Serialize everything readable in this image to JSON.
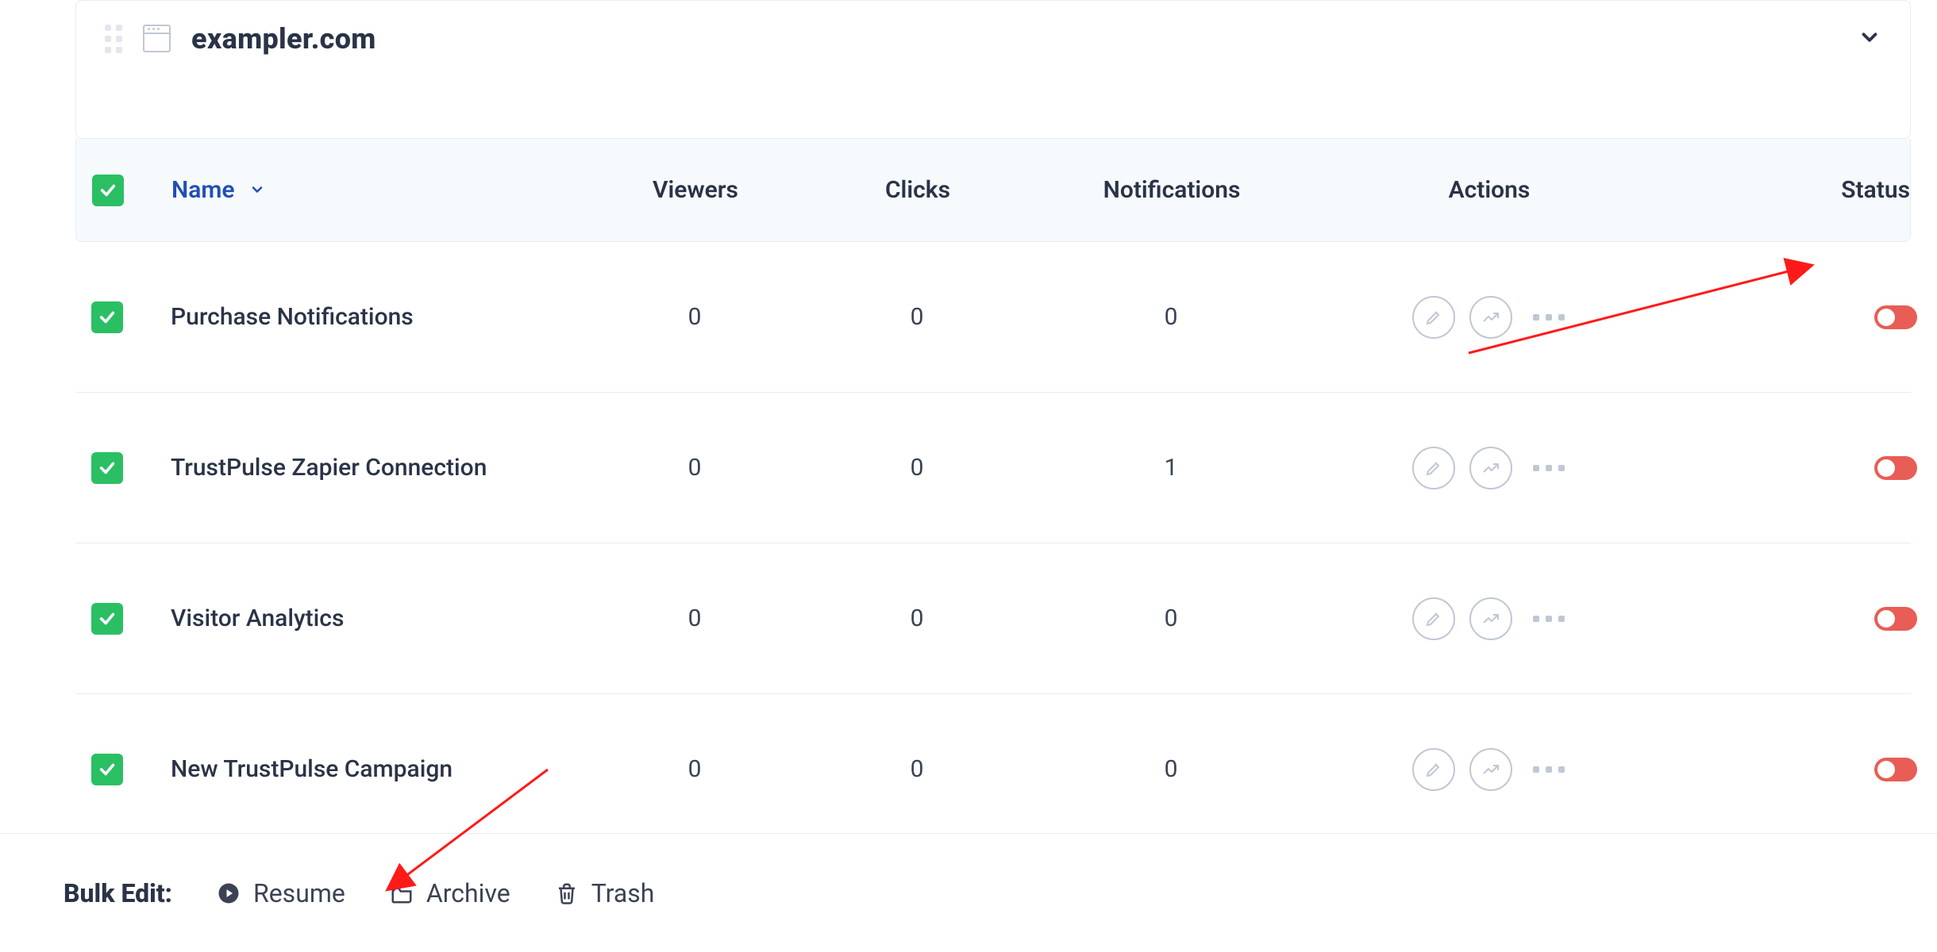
{
  "site": {
    "title": "exampler.com"
  },
  "columns": {
    "name": "Name",
    "viewers": "Viewers",
    "clicks": "Clicks",
    "notifications": "Notifications",
    "actions": "Actions",
    "status": "Status"
  },
  "rows": [
    {
      "name": "Purchase Notifications",
      "viewers": "0",
      "clicks": "0",
      "notifications": "0"
    },
    {
      "name": "TrustPulse Zapier Connection",
      "viewers": "0",
      "clicks": "0",
      "notifications": "1"
    },
    {
      "name": "Visitor Analytics",
      "viewers": "0",
      "clicks": "0",
      "notifications": "0"
    },
    {
      "name": "New TrustPulse Campaign",
      "viewers": "0",
      "clicks": "0",
      "notifications": "0"
    }
  ],
  "bulk": {
    "label": "Bulk Edit:",
    "resume": "Resume",
    "archive": "Archive",
    "trash": "Trash"
  }
}
